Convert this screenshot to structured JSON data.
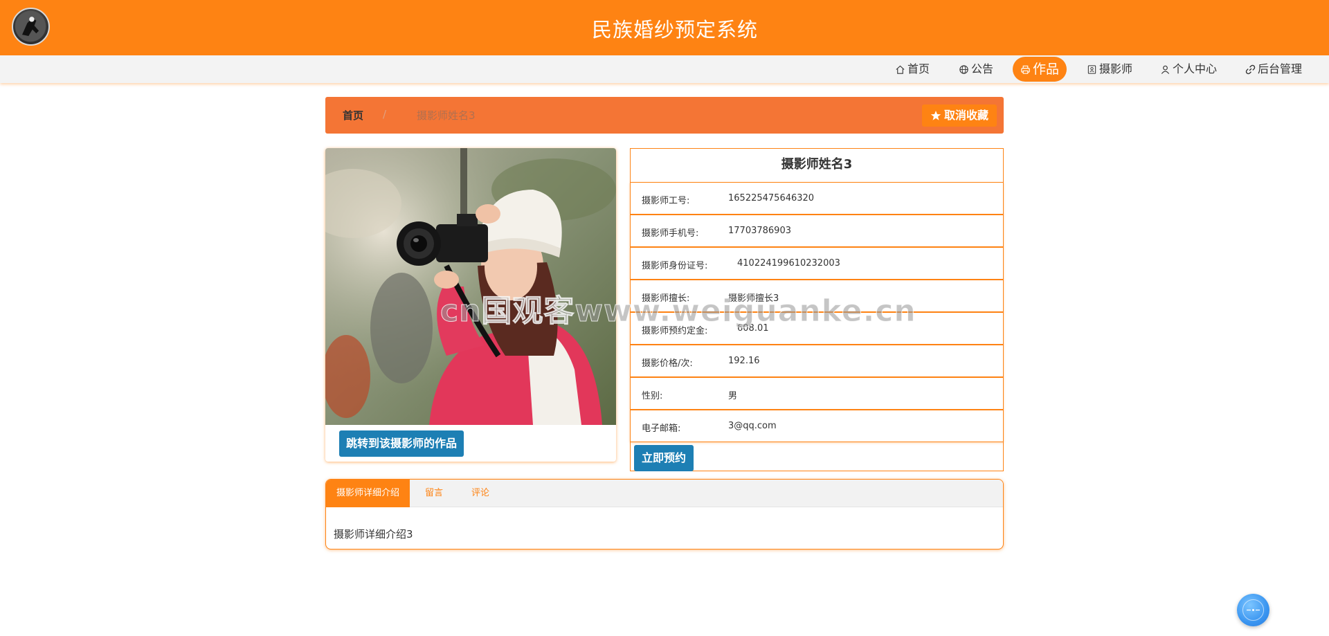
{
  "header": {
    "title": "民族婚纱预定系统"
  },
  "nav": {
    "items": [
      {
        "label": "首页",
        "icon": "home-icon"
      },
      {
        "label": "公告",
        "icon": "globe-icon"
      },
      {
        "label": "作品",
        "icon": "printer-icon",
        "active": true
      },
      {
        "label": "摄影师",
        "icon": "id-card-icon"
      },
      {
        "label": "个人中心",
        "icon": "user-icon"
      },
      {
        "label": "后台管理",
        "icon": "link-icon"
      }
    ]
  },
  "breadcrumb": {
    "home": "首页",
    "separator": "/",
    "current": "摄影师姓名3",
    "favorite_button": "取消收藏"
  },
  "photo_card": {
    "works_button": "跳转到该摄影师的作品"
  },
  "info": {
    "title": "摄影师姓名3",
    "rows": [
      {
        "label": "摄影师工号:",
        "value": "165225475646320"
      },
      {
        "label": "摄影师手机号:",
        "value": "17703786903"
      },
      {
        "label": "摄影师身份证号:",
        "value": "410224199610232003"
      },
      {
        "label": "摄影师擅长:",
        "value": "摄影师擅长3"
      },
      {
        "label": "摄影师预约定金:",
        "value": "608.01"
      },
      {
        "label": "摄影价格/次:",
        "value": "192.16"
      },
      {
        "label": "性别:",
        "value": "男"
      },
      {
        "label": "电子邮箱:",
        "value": "3@qq.com"
      }
    ],
    "book_button": "立即预约"
  },
  "tabs": {
    "items": [
      {
        "label": "摄影师详细介绍",
        "active": true
      },
      {
        "label": "留言"
      },
      {
        "label": "评论"
      }
    ],
    "content": "摄影师详细介绍3"
  },
  "watermark": "cn国观客www.weiguanke.cn",
  "colors": {
    "primary": "#fe8313",
    "breadcrumb_bg": "#f47535",
    "button_blue": "#1d7fb4"
  }
}
